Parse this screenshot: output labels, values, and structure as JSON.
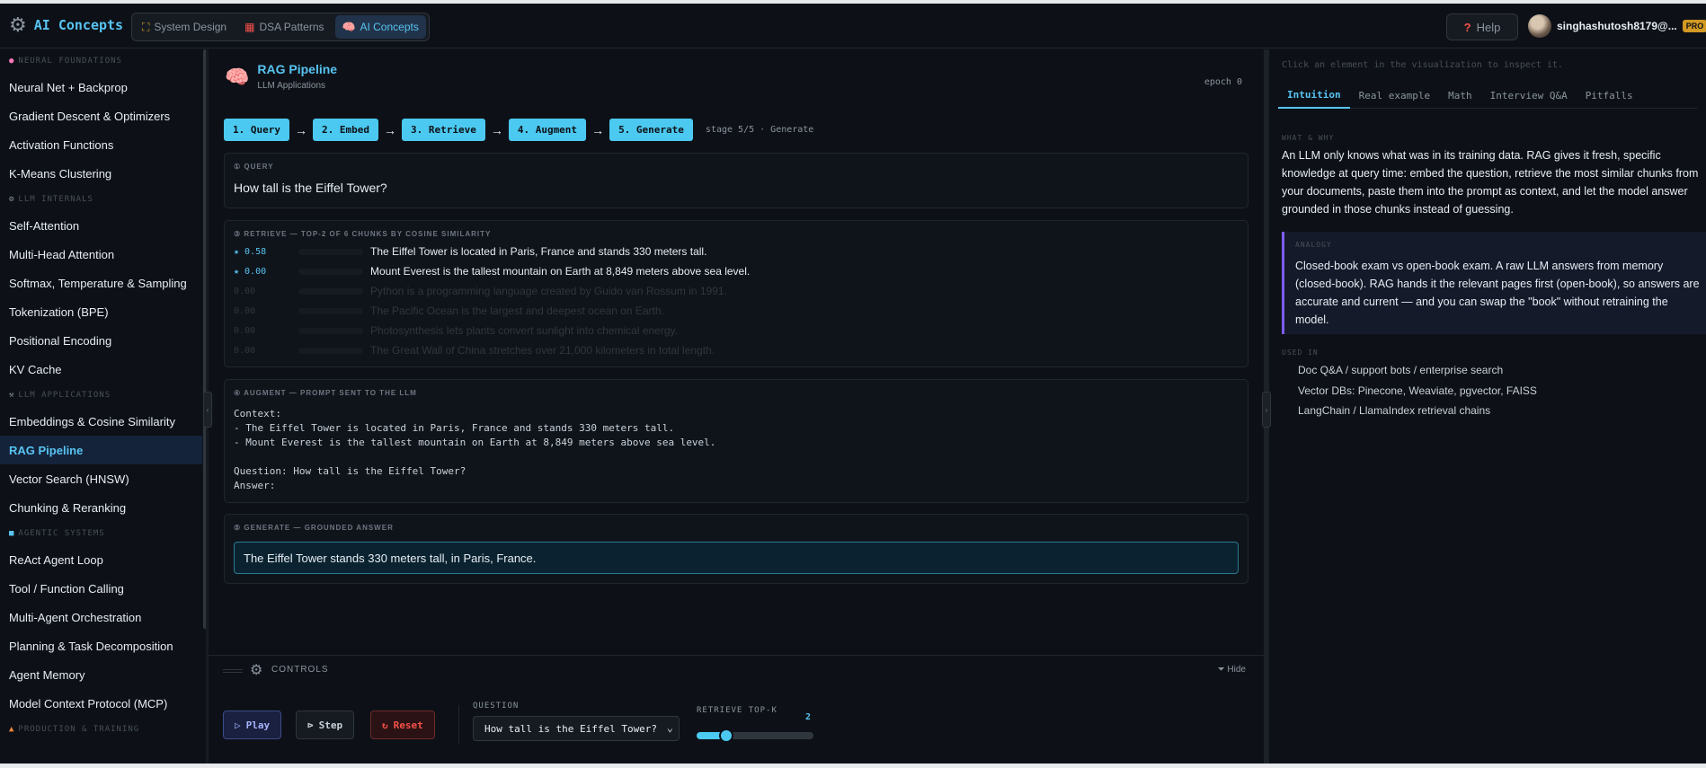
{
  "app": {
    "name": "AI Concepts",
    "icon": "gear-icon"
  },
  "nav": {
    "tabs": [
      {
        "label": "System Design",
        "icon": "blueprint-icon",
        "active": false
      },
      {
        "label": "DSA Patterns",
        "icon": "grid-icon",
        "active": false
      },
      {
        "label": "AI Concepts",
        "icon": "brain-icon",
        "active": true
      }
    ]
  },
  "header": {
    "help_label": "Help",
    "user_email": "singhashutosh8179@...",
    "badge": "PRO"
  },
  "sidebar": {
    "sections": [
      {
        "title": "NEURAL FOUNDATIONS",
        "items": [
          "Neural Net + Backprop",
          "Gradient Descent & Optimizers",
          "Activation Functions",
          "K-Means Clustering"
        ]
      },
      {
        "title": "LLM INTERNALS",
        "items": [
          "Self-Attention",
          "Multi-Head Attention",
          "Softmax, Temperature & Sampling",
          "Tokenization (BPE)",
          "Positional Encoding",
          "KV Cache"
        ]
      },
      {
        "title": "LLM APPLICATIONS",
        "items": [
          "Embeddings & Cosine Similarity",
          "RAG Pipeline",
          "Vector Search (HNSW)",
          "Chunking & Reranking"
        ]
      },
      {
        "title": "AGENTIC SYSTEMS",
        "items": [
          "ReAct Agent Loop",
          "Tool / Function Calling",
          "Multi-Agent Orchestration",
          "Planning & Task Decomposition",
          "Agent Memory",
          "Model Context Protocol (MCP)"
        ]
      },
      {
        "title": "PRODUCTION & TRAINING",
        "items": []
      }
    ],
    "active_item": "RAG Pipeline"
  },
  "page": {
    "title": "RAG Pipeline",
    "subtitle": "LLM Applications",
    "epoch": "epoch 0"
  },
  "stages": {
    "items": [
      "1. Query",
      "2. Embed",
      "3. Retrieve",
      "4. Augment",
      "5. Generate"
    ],
    "info": "stage 5/5 · Generate"
  },
  "query": {
    "label": "① QUERY",
    "text": "How tall is the Eiffel Tower?"
  },
  "retrieve": {
    "label": "③ RETRIEVE — TOP-2 OF 6 CHUNKS BY COSINE SIMILARITY",
    "chunks": [
      {
        "score": "★ 0.58",
        "fill": 1.0,
        "selected": true,
        "text": "The Eiffel Tower is located in Paris, France and stands 330 meters tall."
      },
      {
        "score": "★ 0.00",
        "fill": 0.0,
        "selected": true,
        "text": "Mount Everest is the tallest mountain on Earth at 8,849 meters above sea level."
      },
      {
        "score": "0.00",
        "fill": 0.0,
        "selected": false,
        "text": "Python is a programming language created by Guido van Rossum in 1991."
      },
      {
        "score": "0.00",
        "fill": 0.0,
        "selected": false,
        "text": "The Pacific Ocean is the largest and deepest ocean on Earth."
      },
      {
        "score": "0.00",
        "fill": 0.0,
        "selected": false,
        "text": "Photosynthesis lets plants convert sunlight into chemical energy."
      },
      {
        "score": "0.00",
        "fill": 0.0,
        "selected": false,
        "text": "The Great Wall of China stretches over 21,000 kilometers in total length."
      }
    ]
  },
  "augment": {
    "label": "④ AUGMENT — PROMPT SENT TO THE LLM",
    "prompt": "Context:\n- The Eiffel Tower is located in Paris, France and stands 330 meters tall.\n- Mount Everest is the tallest mountain on Earth at 8,849 meters above sea level.\n\nQuestion: How tall is the Eiffel Tower?\nAnswer:"
  },
  "generate": {
    "label": "⑤ GENERATE — GROUNDED ANSWER",
    "answer": "The Eiffel Tower stands 330 meters tall, in Paris, France."
  },
  "controls": {
    "title": "CONTROLS",
    "hide_label": "Hide",
    "play_label": "Play",
    "step_label": "Step",
    "reset_label": "Reset",
    "question_label": "QUESTION",
    "question_value": "How tall is the Eiffel Tower?",
    "topk_label": "RETRIEVE TOP-K",
    "topk_value": "2",
    "topk_fraction": 0.25
  },
  "panel": {
    "hint": "Click an element in the visualization to inspect it.",
    "tabs": [
      "Intuition",
      "Real example",
      "Math",
      "Interview Q&A",
      "Pitfalls"
    ],
    "active_tab": "Intuition",
    "what_label": "WHAT & WHY",
    "what_text": "An LLM only knows what was in its training data. RAG gives it fresh, specific knowledge at query time: embed the question, retrieve the most similar chunks from your documents, paste them into the prompt as context, and let the model answer grounded in those chunks instead of guessing.",
    "analogy_label": "ANALOGY",
    "analogy_text": "Closed-book exam vs open-book exam. A raw LLM answers from memory (closed-book). RAG hands it the relevant pages first (open-book), so answers are accurate and current — and you can swap the \"book\" without retraining the model.",
    "used_label": "USED IN",
    "used_items": [
      "Doc Q&A / support bots / enterprise search",
      "Vector DBs: Pinecone, Weaviate, pgvector, FAISS",
      "LangChain / LlamaIndex retrieval chains"
    ]
  },
  "colors": {
    "accent": "#58c4f2",
    "stage_bg": "#4cc9f0",
    "background": "#0d1117",
    "analogy_border": "#7c5cff",
    "reset": "#f85149"
  }
}
